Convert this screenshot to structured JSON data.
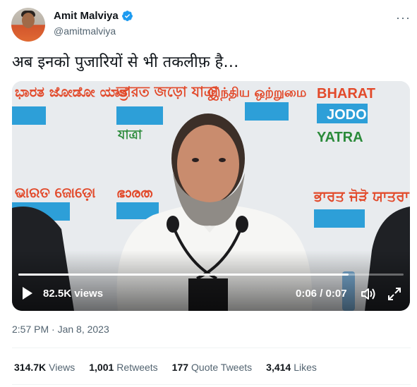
{
  "author": {
    "name": "Amit Malviya",
    "handle": "@amitmalviya"
  },
  "more_icon": "more-horizontal-icon",
  "tweet": {
    "text": "अब इनको पुजारियों से भी तकलीफ़ है…"
  },
  "video": {
    "views": "82.5K views",
    "time": "0:06 / 0:07",
    "progress": 0.857,
    "backdrop_text": {
      "left_top": "ಭಾರತ ಜೋಡೋ ಯಾತ್ರೆ",
      "center_top": "ভারত জড়ো যাত্রা",
      "center_right_top": "இந்திய ஒற்றுமை",
      "right_top": [
        "BHARAT",
        "JODO",
        "YATRA"
      ],
      "left_bottom": "ଭାରତ ଜୋଡ଼ୋ",
      "right_bottom": "ਭਾਰਤ ਜੋੜੋ ਯਾਤਰਾ"
    }
  },
  "meta": {
    "timestamp": "2:57 PM · Jan 8, 2023"
  },
  "stats": [
    {
      "num": "314.7K",
      "label": "Views"
    },
    {
      "num": "1,001",
      "label": "Retweets"
    },
    {
      "num": "177",
      "label": "Quote Tweets"
    },
    {
      "num": "3,414",
      "label": "Likes"
    }
  ],
  "colors": {
    "verified": "#1d9bf0",
    "secondary_text": "#536471",
    "primary_text": "#0f1419"
  }
}
